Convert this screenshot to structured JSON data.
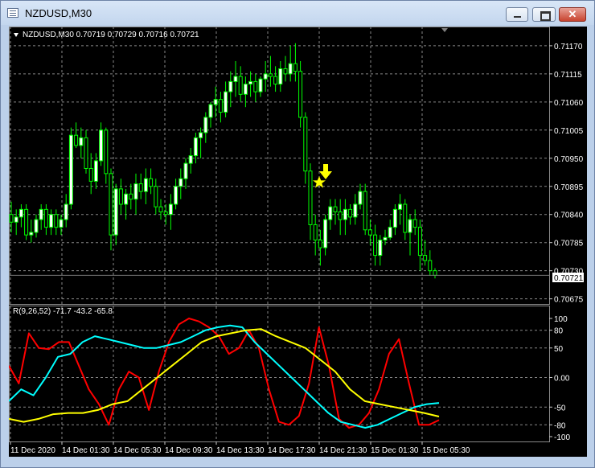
{
  "window": {
    "title": "NZDUSD,M30",
    "minimize_icon": "minimize-icon",
    "maximize_icon": "maximize-icon",
    "close_icon": "close-icon",
    "close_glyph": "✕"
  },
  "chart": {
    "header": "NZDUSD,M30  0.70719 0.70729 0.70716 0.70721",
    "current_price": "0.70721",
    "price_ticks": [
      "0.71170",
      "0.71115",
      "0.71060",
      "0.71005",
      "0.70950",
      "0.70895",
      "0.70840",
      "0.70785",
      "0.70730",
      "0.70675"
    ],
    "time_ticks": [
      "11 Dec 2020",
      "14 Dec 01:30",
      "14 Dec 05:30",
      "14 Dec 09:30",
      "14 Dec 13:30",
      "14 Dec 17:30",
      "14 Dec 21:30",
      "15 Dec 01:30",
      "15 Dec 05:30"
    ],
    "indicator_header": "R(9,26,52) -71.7 -43.2 -65.8",
    "indicator_ticks": [
      "100",
      "80",
      "50",
      "0.00",
      "-50",
      "-80",
      "-100"
    ],
    "colors": {
      "background": "#000000",
      "bull_candle": "#ffffff",
      "bear_candle": "#000000",
      "candle_outline": "#00ff00",
      "grid": "#888888",
      "red_line": "#ff0000",
      "cyan_line": "#00ffff",
      "yellow_line": "#ffff00",
      "signal": "#ffff00"
    }
  },
  "chart_data": [
    {
      "type": "candlestick",
      "symbol": "NZDUSD",
      "timeframe": "M30",
      "ylim": [
        0.70665,
        0.71195
      ],
      "ohlc": [
        [
          0.7084,
          0.70865,
          0.70805,
          0.70825
        ],
        [
          0.70825,
          0.7085,
          0.708,
          0.70835
        ],
        [
          0.70835,
          0.7086,
          0.70815,
          0.7085
        ],
        [
          0.7085,
          0.7086,
          0.7079,
          0.708
        ],
        [
          0.708,
          0.7083,
          0.70785,
          0.70805
        ],
        [
          0.70805,
          0.7084,
          0.70795,
          0.7083
        ],
        [
          0.7083,
          0.7086,
          0.7081,
          0.7085
        ],
        [
          0.7085,
          0.7086,
          0.708,
          0.70815
        ],
        [
          0.70815,
          0.7085,
          0.708,
          0.7084
        ],
        [
          0.7084,
          0.7085,
          0.708,
          0.70815
        ],
        [
          0.70815,
          0.7084,
          0.708,
          0.7083
        ],
        [
          0.7083,
          0.7088,
          0.70815,
          0.7086
        ],
        [
          0.7086,
          0.7101,
          0.7085,
          0.70995
        ],
        [
          0.70995,
          0.7102,
          0.7097,
          0.70975
        ],
        [
          0.70975,
          0.7101,
          0.7095,
          0.7099
        ],
        [
          0.7099,
          0.71005,
          0.7092,
          0.7093
        ],
        [
          0.7093,
          0.7096,
          0.7088,
          0.70905
        ],
        [
          0.70905,
          0.7096,
          0.7089,
          0.70945
        ],
        [
          0.70945,
          0.7102,
          0.70935,
          0.71005
        ],
        [
          0.71005,
          0.7101,
          0.709,
          0.7092
        ],
        [
          0.7092,
          0.7093,
          0.7077,
          0.708
        ],
        [
          0.708,
          0.709,
          0.7078,
          0.7089
        ],
        [
          0.7089,
          0.7091,
          0.7084,
          0.7086
        ],
        [
          0.7086,
          0.7089,
          0.7083,
          0.7088
        ],
        [
          0.7088,
          0.709,
          0.7085,
          0.7087
        ],
        [
          0.7087,
          0.7092,
          0.7084,
          0.709
        ],
        [
          0.709,
          0.7092,
          0.7087,
          0.70885
        ],
        [
          0.70885,
          0.7093,
          0.7086,
          0.7091
        ],
        [
          0.7091,
          0.7093,
          0.7088,
          0.70895
        ],
        [
          0.70895,
          0.7091,
          0.7084,
          0.70855
        ],
        [
          0.70855,
          0.7087,
          0.7083,
          0.70845
        ],
        [
          0.70845,
          0.7086,
          0.7082,
          0.7084
        ],
        [
          0.7084,
          0.7088,
          0.7081,
          0.7086
        ],
        [
          0.7086,
          0.7091,
          0.7085,
          0.70895
        ],
        [
          0.70895,
          0.7093,
          0.7087,
          0.7091
        ],
        [
          0.7091,
          0.7095,
          0.7089,
          0.7094
        ],
        [
          0.7094,
          0.7097,
          0.7092,
          0.70955
        ],
        [
          0.70955,
          0.71,
          0.7094,
          0.7099
        ],
        [
          0.7099,
          0.7101,
          0.7095,
          0.71
        ],
        [
          0.71,
          0.7104,
          0.7098,
          0.7103
        ],
        [
          0.7103,
          0.7106,
          0.7101,
          0.71055
        ],
        [
          0.71055,
          0.7109,
          0.7103,
          0.71065
        ],
        [
          0.71065,
          0.7108,
          0.7102,
          0.7104
        ],
        [
          0.7104,
          0.711,
          0.7103,
          0.7108
        ],
        [
          0.7108,
          0.7112,
          0.7105,
          0.711
        ],
        [
          0.711,
          0.7114,
          0.7107,
          0.7111
        ],
        [
          0.7111,
          0.7113,
          0.7106,
          0.71075
        ],
        [
          0.71075,
          0.7111,
          0.7105,
          0.71095
        ],
        [
          0.71095,
          0.7112,
          0.7107,
          0.711
        ],
        [
          0.711,
          0.71115,
          0.7106,
          0.7108
        ],
        [
          0.7108,
          0.7111,
          0.7107,
          0.71105
        ],
        [
          0.71105,
          0.7114,
          0.7108,
          0.71115
        ],
        [
          0.71115,
          0.7115,
          0.7109,
          0.7111
        ],
        [
          0.7111,
          0.7113,
          0.7108,
          0.71095
        ],
        [
          0.71095,
          0.7114,
          0.7108,
          0.71125
        ],
        [
          0.71125,
          0.7115,
          0.711,
          0.71115
        ],
        [
          0.71115,
          0.7117,
          0.711,
          0.71135
        ],
        [
          0.71135,
          0.71175,
          0.711,
          0.7112
        ],
        [
          0.7112,
          0.7114,
          0.7101,
          0.7103
        ],
        [
          0.7103,
          0.7104,
          0.709,
          0.70925
        ],
        [
          0.70925,
          0.7094,
          0.7079,
          0.7082
        ],
        [
          0.7082,
          0.7084,
          0.7076,
          0.7079
        ],
        [
          0.7079,
          0.7081,
          0.7074,
          0.70775
        ],
        [
          0.70775,
          0.7084,
          0.7076,
          0.7083
        ],
        [
          0.7083,
          0.7087,
          0.7081,
          0.70855
        ],
        [
          0.70855,
          0.7087,
          0.7082,
          0.70845
        ],
        [
          0.70845,
          0.7087,
          0.708,
          0.7083
        ],
        [
          0.7083,
          0.7087,
          0.708,
          0.7085
        ],
        [
          0.7085,
          0.7086,
          0.7082,
          0.70835
        ],
        [
          0.70835,
          0.7088,
          0.7082,
          0.7086
        ],
        [
          0.7086,
          0.709,
          0.7085,
          0.70885
        ],
        [
          0.70885,
          0.709,
          0.708,
          0.7081
        ],
        [
          0.7081,
          0.7083,
          0.7078,
          0.708
        ],
        [
          0.708,
          0.7082,
          0.7074,
          0.7076
        ],
        [
          0.7076,
          0.708,
          0.7074,
          0.7079
        ],
        [
          0.7079,
          0.7081,
          0.7078,
          0.70795
        ],
        [
          0.70795,
          0.7083,
          0.7079,
          0.70815
        ],
        [
          0.70815,
          0.7086,
          0.708,
          0.7085
        ],
        [
          0.7085,
          0.7088,
          0.7082,
          0.7086
        ],
        [
          0.7086,
          0.7087,
          0.7079,
          0.70805
        ],
        [
          0.70805,
          0.7084,
          0.7076,
          0.7083
        ],
        [
          0.7083,
          0.7085,
          0.708,
          0.70815
        ],
        [
          0.70815,
          0.7083,
          0.7073,
          0.7076
        ],
        [
          0.7076,
          0.7079,
          0.7074,
          0.7075
        ],
        [
          0.7075,
          0.7077,
          0.7072,
          0.7073
        ],
        [
          0.7073,
          0.70735,
          0.70715,
          0.70721
        ]
      ],
      "signal": {
        "type": "arrow-down-and-star",
        "candle_index": 70,
        "color": "#ffff00"
      }
    },
    {
      "type": "line",
      "title": "R(9,26,52)",
      "ylim": [
        -100,
        100
      ],
      "series": [
        {
          "name": "R(9)",
          "color": "#ff0000",
          "last": -71.7,
          "values": [
            20,
            -10,
            75,
            50,
            48,
            60,
            60,
            20,
            -20,
            -45,
            -80,
            -20,
            10,
            0,
            -55,
            10,
            60,
            90,
            100,
            95,
            85,
            70,
            40,
            50,
            80,
            50,
            -20,
            -75,
            -80,
            -65,
            -10,
            85,
            20,
            -70,
            -85,
            -80,
            -60,
            -20,
            40,
            65,
            -10,
            -80,
            -80,
            -72
          ]
        },
        {
          "name": "R(26)",
          "color": "#00ffff",
          "last": -43.2,
          "values": [
            -40,
            -20,
            -30,
            0,
            35,
            40,
            60,
            70,
            65,
            60,
            55,
            50,
            50,
            55,
            60,
            70,
            80,
            85,
            88,
            85,
            60,
            40,
            20,
            0,
            -20,
            -40,
            -60,
            -75,
            -80,
            -85,
            -80,
            -70,
            -60,
            -50,
            -45,
            -43
          ]
        },
        {
          "name": "R(52)",
          "color": "#ffff00",
          "last": -65.8,
          "values": [
            -70,
            -75,
            -70,
            -62,
            -60,
            -60,
            -55,
            -45,
            -40,
            -20,
            0,
            20,
            40,
            60,
            70,
            75,
            80,
            82,
            70,
            60,
            50,
            30,
            10,
            -20,
            -40,
            -45,
            -50,
            -55,
            -60,
            -66
          ]
        }
      ]
    }
  ]
}
